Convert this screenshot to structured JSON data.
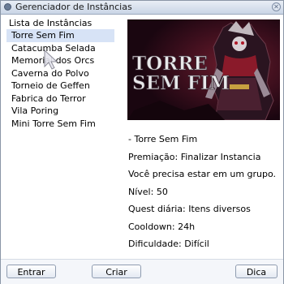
{
  "window": {
    "title": "Gerenciador de Instâncias"
  },
  "list": {
    "header": "Lista de Instâncias",
    "items": [
      "Torre Sem Fim",
      "Catacumba Selada",
      "Memorial dos Orcs",
      "Caverna do Polvo",
      "Torneio de Geffen",
      "Fabrica do Terror",
      "Vila Poring",
      "Mini Torre Sem Fim"
    ],
    "selected": "Torre Sem Fim"
  },
  "art": {
    "title_line1": "TORRE",
    "title_line2": "SEM FIM"
  },
  "details": {
    "name": "- Torre Sem Fim",
    "reward": "Premiação: Finalizar Instancia",
    "group_note": "Você precisa estar em um grupo.",
    "level": "Nível: 50",
    "daily_quest": "Quest diária: Itens diversos",
    "cooldown": "Cooldown: 24h",
    "difficulty": "Dificuldade: Difícil"
  },
  "buttons": {
    "enter": "Entrar",
    "create": "Criar",
    "tip": "Dica"
  },
  "colors": {
    "selection": "#d7e3f6",
    "titlebar": "#c9d5e6",
    "art_text": "#e8e8ea"
  }
}
